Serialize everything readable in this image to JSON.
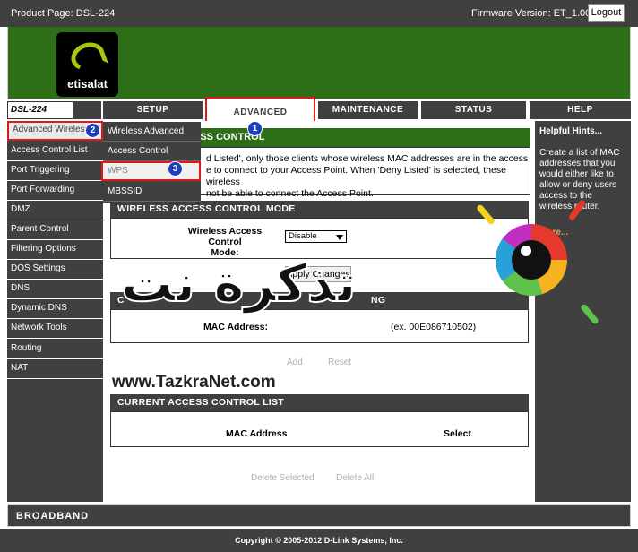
{
  "topbar": {
    "product": "Product Page: DSL-224",
    "firmware": "Firmware Version: ET_1.00",
    "logout_label": "Logout"
  },
  "brand": {
    "logo_text": "etisalat",
    "model": "DSL-224"
  },
  "tabs": [
    {
      "label": "SETUP"
    },
    {
      "label": "ADVANCED"
    },
    {
      "label": "MAINTENANCE"
    },
    {
      "label": "STATUS"
    },
    {
      "label": "HELP"
    }
  ],
  "sidebar": {
    "items": [
      {
        "label": "Advanced Wireless"
      },
      {
        "label": "Access Control List"
      },
      {
        "label": "Port Triggering"
      },
      {
        "label": "Port Forwarding"
      },
      {
        "label": "DMZ"
      },
      {
        "label": "Parent Control"
      },
      {
        "label": "Filtering Options"
      },
      {
        "label": "DOS Settings"
      },
      {
        "label": "DNS"
      },
      {
        "label": "Dynamic DNS"
      },
      {
        "label": "Network Tools"
      },
      {
        "label": "Routing"
      },
      {
        "label": "NAT"
      }
    ]
  },
  "dropdown": {
    "items": [
      {
        "label": "Wireless Advanced"
      },
      {
        "label": "Access Control"
      },
      {
        "label": "WPS"
      },
      {
        "label": "MBSSID"
      }
    ]
  },
  "main": {
    "section_header_partial": "ESS CONTROL",
    "intro_line1": "d Listed', only those clients whose wireless MAC addresses are in the access",
    "intro_line2": "e to connect to your Access Point. When 'Deny Listed' is selected, these wireless",
    "intro_line3": "not be able to connect the Access Point.",
    "mode_header": "WIRELESS ACCESS CONTROL MODE",
    "mode_label_line1": "Wireless Access Control",
    "mode_label_line2": "Mode:",
    "mode_value": "Disable",
    "apply_label": "Apply Changes",
    "add_header_partial": "C",
    "add_header_suffix": "NG",
    "mac_label": "MAC Address:",
    "mac_example": "(ex. 00E086710502)",
    "add_label": "Add",
    "reset_label": "Reset",
    "list_header": "CURRENT ACCESS CONTROL LIST",
    "col_mac": "MAC Address",
    "col_select": "Select",
    "delete_selected": "Delete Selected",
    "delete_all": "Delete All"
  },
  "hints": {
    "title": "Helpful Hints...",
    "text": "Create a list of MAC addresses that you would either like to allow or deny users access to the wireless router.",
    "more": "More..."
  },
  "badges": [
    "1",
    "2",
    "3"
  ],
  "footer": {
    "brand": "BROADBAND",
    "copyright": "Copyright © 2005-2012 D-Link Systems, Inc."
  },
  "watermark": {
    "arabic": "تذكرة نت",
    "url": "www.TazkraNet.com"
  },
  "colors": {
    "banner_green": "#2e6e16",
    "dark_gray": "#404040",
    "highlight_red": "#e01818",
    "badge_blue": "#1a3fbf"
  }
}
